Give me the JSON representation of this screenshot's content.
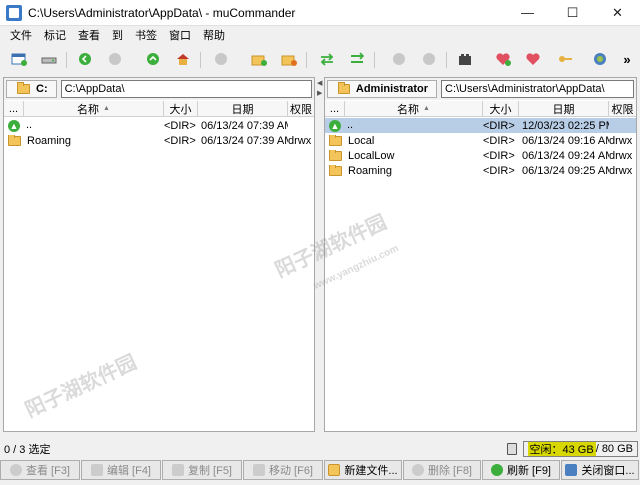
{
  "window": {
    "title": "C:\\Users\\Administrator\\AppData\\ - muCommander",
    "minimize": "—",
    "maximize": "☐",
    "close": "✕"
  },
  "menu": [
    "文件",
    "标记",
    "查看",
    "到",
    "书签",
    "窗口",
    "帮助"
  ],
  "toolbar": {
    "overflow": "»"
  },
  "left_panel": {
    "drive": "C:",
    "path": "C:\\AppData\\",
    "columns": {
      "ext": "...",
      "name": "名称",
      "size": "大小",
      "date": "日期",
      "perm": "权限"
    },
    "rows": [
      {
        "name": "..",
        "size": "<DIR>",
        "date": "06/13/24 07:39 AM",
        "perm": "",
        "type": "up"
      },
      {
        "name": "Roaming",
        "size": "<DIR>",
        "date": "06/13/24 07:39 AM",
        "perm": "drwx",
        "type": "folder"
      }
    ]
  },
  "right_panel": {
    "drive": "Administrator",
    "path": "C:\\Users\\Administrator\\AppData\\",
    "columns": {
      "ext": "...",
      "name": "名称",
      "size": "大小",
      "date": "日期",
      "perm": "权限"
    },
    "rows": [
      {
        "name": "..",
        "size": "<DIR>",
        "date": "12/03/23 02:25 PM",
        "perm": "",
        "type": "up"
      },
      {
        "name": "Local",
        "size": "<DIR>",
        "date": "06/13/24 09:16 AM",
        "perm": "drwx",
        "type": "folder"
      },
      {
        "name": "LocalLow",
        "size": "<DIR>",
        "date": "06/13/24 09:24 AM",
        "perm": "drwx",
        "type": "folder"
      },
      {
        "name": "Roaming",
        "size": "<DIR>",
        "date": "06/13/24 09:25 AM",
        "perm": "drwx",
        "type": "folder"
      }
    ]
  },
  "status": {
    "selection": "0 / 3 选定",
    "free_space": "空闲：43 GB",
    "total_space": " / 80 GB"
  },
  "function_keys": [
    {
      "label": "查看 [F3]",
      "enabled": false
    },
    {
      "label": "编辑 [F4]",
      "enabled": false
    },
    {
      "label": "复制 [F5]",
      "enabled": false
    },
    {
      "label": "移动 [F6]",
      "enabled": false
    },
    {
      "label": "新建文件...",
      "enabled": true
    },
    {
      "label": "删除 [F8]",
      "enabled": false
    },
    {
      "label": "刷新 [F9]",
      "enabled": true
    },
    {
      "label": "关闭窗口...",
      "enabled": true
    }
  ],
  "watermark": {
    "text": "阳子湖软件园",
    "url": "www.yangzhiu.com"
  },
  "colors": {
    "selection": "#b8cde6",
    "free_space_bar": "#d8d800",
    "folder": "#f2c45a"
  }
}
